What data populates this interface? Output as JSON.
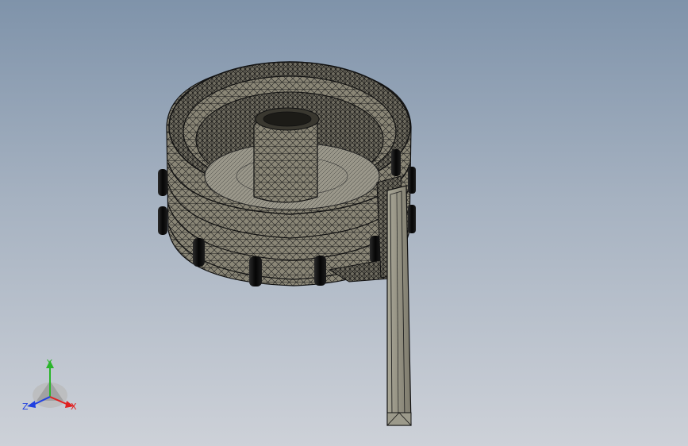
{
  "viewport": {
    "background_top": "#7f93aa",
    "background_bottom": "#cdd1d8"
  },
  "model": {
    "display_style": "wireframe-shaded",
    "face_color": "#8a8676",
    "edge_color": "#111111"
  },
  "triad": {
    "axes": [
      {
        "label": "Y",
        "color": "#2ab52a"
      },
      {
        "label": "X",
        "color": "#e02020"
      },
      {
        "label": "Z",
        "color": "#2040e0"
      }
    ]
  }
}
